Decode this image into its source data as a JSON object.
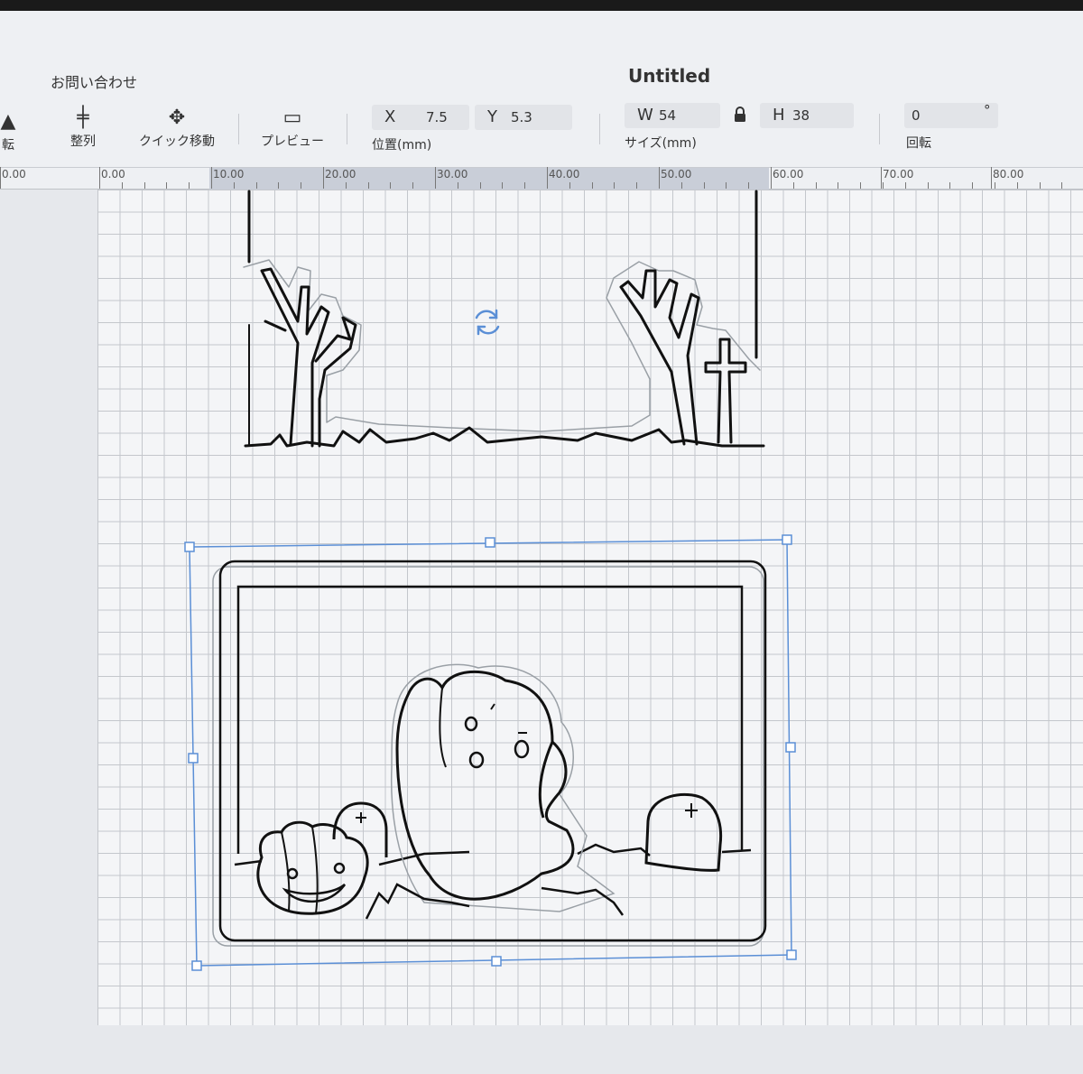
{
  "app": {
    "menu_contact": "お問い合わせ",
    "title": "Untitled"
  },
  "toolbar": {
    "rotate_partial": "転",
    "align": {
      "label": "整列",
      "icon": "align-icon"
    },
    "quick_move": {
      "label": "クイック移動",
      "icon": "move-arrows-icon"
    },
    "preview": {
      "label": "プレビュー",
      "icon": "monitor-icon"
    },
    "position": {
      "label": "位置(mm)",
      "x_key": "X",
      "x": "7.5",
      "y_key": "Y",
      "y": "5.3"
    },
    "size": {
      "label": "サイズ(mm)",
      "w_key": "W",
      "w": "54",
      "h_key": "H",
      "h": "38",
      "lock_icon": "lock-icon"
    },
    "rotation": {
      "label": "回転",
      "value": "0",
      "unit": "°"
    }
  },
  "ruler": {
    "labels": [
      "0.00",
      "0.00",
      "10.00",
      "20.00",
      "30.00",
      "40.00",
      "50.00",
      "60.00",
      "70.00",
      "80.00"
    ]
  },
  "canvas": {
    "rotate_handle_icon": "rotate-handle-icon",
    "designs": [
      "graveyard-trees-layer",
      "ghost-pumpkin-frame-layer"
    ]
  },
  "colors": {
    "selection": "#5b8fd6",
    "grid": "#c4c7cc",
    "ruler_highlight": "#c9ced8"
  }
}
